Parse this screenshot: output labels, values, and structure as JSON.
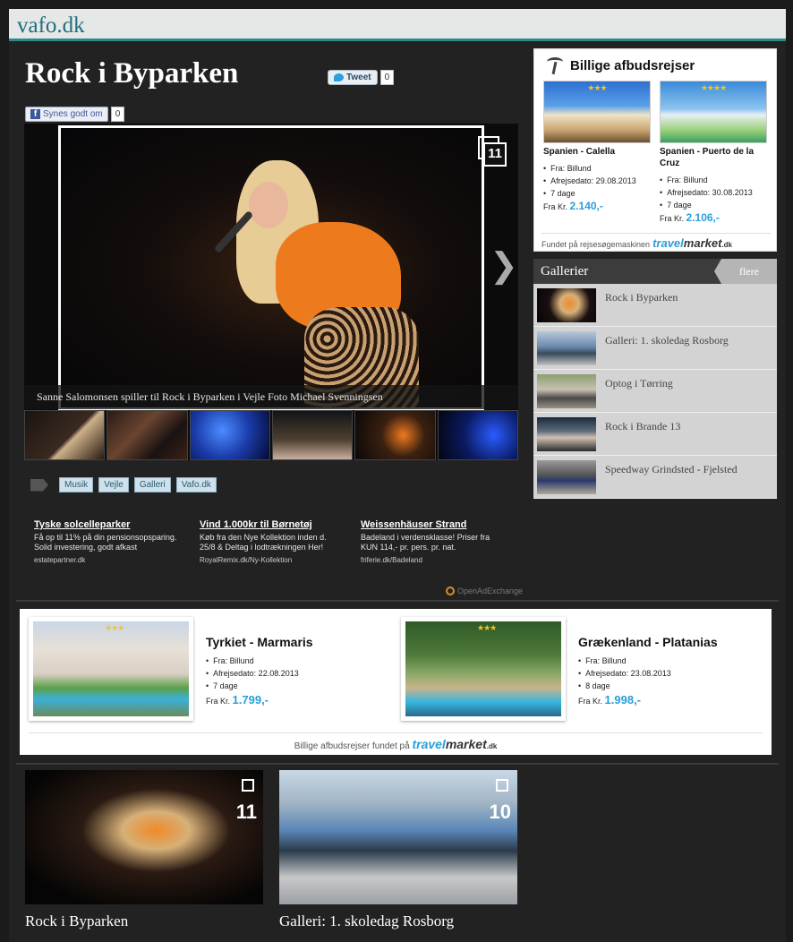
{
  "site": {
    "logo": "vafo.dk"
  },
  "article": {
    "title": "Rock i Byparken",
    "tweet_label": "Tweet",
    "tweet_count": "0",
    "like_label": "Synes godt om",
    "like_count": "0",
    "gallery_count": "11",
    "caption": "Sanne Salomonsen spiller til Rock i Byparken i Vejle Foto Michael Svenningsen",
    "tags": [
      "Musik",
      "Vejle",
      "Galleri",
      "Vafo.dk"
    ]
  },
  "ads": [
    {
      "title": "Tyske solcelleparker",
      "desc": "Få op til 11% på din pensionsopsparing. Solid investering, godt afkast",
      "url": "estatepartner.dk"
    },
    {
      "title": "Vind 1.000kr til Børnetøj",
      "desc": "Køb fra den Nye Kollektion inden d. 25/8 & Deltag i lodtrækningen Her!",
      "url": "RoyalRemix.dk/Ny-Kollektion"
    },
    {
      "title": "Weissenhäuser Strand",
      "desc": "Badeland i verdensklasse! Priser fra KUN 114,- pr. pers. pr. nat.",
      "url": "friferie.dk/Badeland"
    }
  ],
  "openad_label": "OpenAdExchange",
  "travel": {
    "offers": [
      {
        "title": "Tyrkiet - Marmaris",
        "stars": "★★★",
        "details": [
          "Fra: Billund",
          "Afrejsedato: 22.08.2013",
          "7 dage"
        ],
        "price_prefix": "Fra Kr.",
        "price": "1.799,-"
      },
      {
        "title": "Grækenland - Platanias",
        "stars": "★★★",
        "details": [
          "Fra: Billund",
          "Afrejsedato: 23.08.2013",
          "8 dage"
        ],
        "price_prefix": "Fra Kr.",
        "price": "1.998,-"
      }
    ],
    "footer_text": "Billige afbudsrejser fundet på",
    "logo_a": "travel",
    "logo_b": "market",
    "logo_c": ".dk"
  },
  "bottom_galleries": [
    {
      "title": "Rock i Byparken",
      "count": "11"
    },
    {
      "title": "Galleri: 1. skoledag Rosborg",
      "count": "10"
    }
  ],
  "sidebar": {
    "promo_title": "Billige afbudsrejser",
    "deals": [
      {
        "title": "Spanien - Calella",
        "stars": "★★★",
        "details": [
          "Fra: Billund",
          "Afrejsedato: 29.08.2013",
          "7 dage"
        ],
        "price_prefix": "Fra Kr.",
        "price": "2.140,-"
      },
      {
        "title": "Spanien - Puerto de la Cruz",
        "stars": "★★★★",
        "details": [
          "Fra: Billund",
          "Afrejsedato: 30.08.2013",
          "7 dage"
        ],
        "price_prefix": "Fra Kr.",
        "price": "2.106,-"
      }
    ],
    "promo_footer": "Fundet på rejsesøgemaskinen",
    "gallery_title": "Gallerier",
    "gallery_more": "flere",
    "gallery_items": [
      "Rock i Byparken",
      "Galleri: 1. skoledag Rosborg",
      "Optog i Tørring",
      "Rock i Brande 13",
      "Speedway Grindsted - Fjelsted"
    ]
  },
  "colors": {
    "accent": "#2a8c86",
    "price_blue": "#2a9ed8",
    "page_bg": "#222222"
  }
}
